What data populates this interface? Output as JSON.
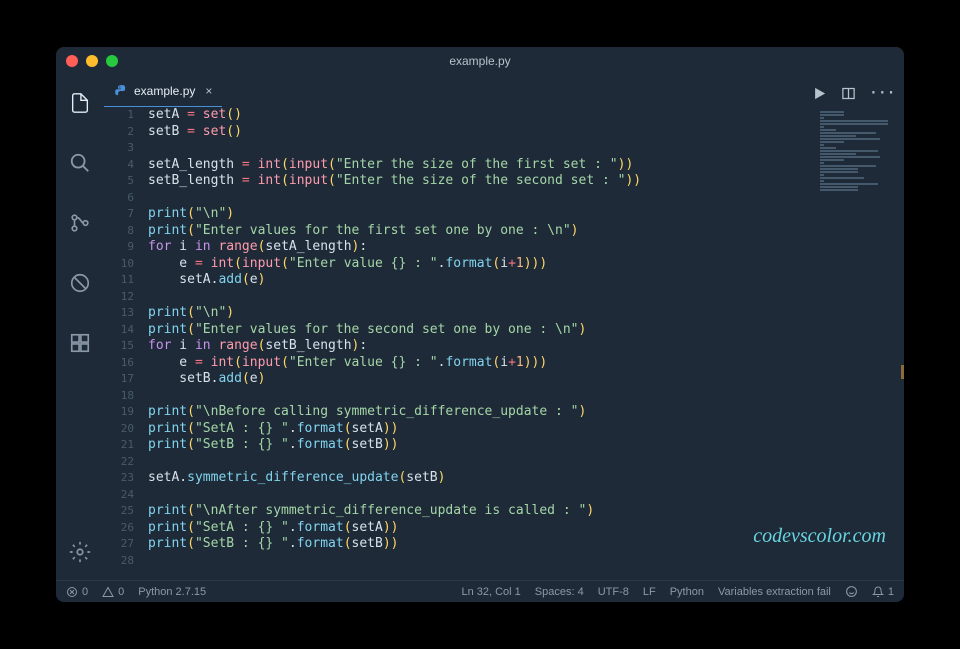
{
  "window": {
    "title": "example.py"
  },
  "tab": {
    "filename": "example.py"
  },
  "code_lines": [
    [
      [
        "var",
        "setA"
      ],
      [
        "op",
        " = "
      ],
      [
        "builtin",
        "set"
      ],
      [
        "paren",
        "()"
      ]
    ],
    [
      [
        "var",
        "setB"
      ],
      [
        "op",
        " = "
      ],
      [
        "builtin",
        "set"
      ],
      [
        "paren",
        "()"
      ]
    ],
    [],
    [
      [
        "var",
        "setA_length"
      ],
      [
        "op",
        " = "
      ],
      [
        "builtin",
        "int"
      ],
      [
        "paren",
        "("
      ],
      [
        "builtin",
        "input"
      ],
      [
        "paren",
        "("
      ],
      [
        "str",
        "\"Enter the size of the first set : \""
      ],
      [
        "paren",
        "))"
      ]
    ],
    [
      [
        "var",
        "setB_length"
      ],
      [
        "op",
        " = "
      ],
      [
        "builtin",
        "int"
      ],
      [
        "paren",
        "("
      ],
      [
        "builtin",
        "input"
      ],
      [
        "paren",
        "("
      ],
      [
        "str",
        "\"Enter the size of the second set : \""
      ],
      [
        "paren",
        "))"
      ]
    ],
    [],
    [
      [
        "call",
        "print"
      ],
      [
        "paren",
        "("
      ],
      [
        "str",
        "\"\\n\""
      ],
      [
        "paren",
        ")"
      ]
    ],
    [
      [
        "call",
        "print"
      ],
      [
        "paren",
        "("
      ],
      [
        "str",
        "\"Enter values for the first set one by one : \\n\""
      ],
      [
        "paren",
        ")"
      ]
    ],
    [
      [
        "kw",
        "for"
      ],
      [
        "var",
        " i "
      ],
      [
        "kw",
        "in"
      ],
      [
        "var",
        " "
      ],
      [
        "builtin",
        "range"
      ],
      [
        "paren",
        "("
      ],
      [
        "var",
        "setA_length"
      ],
      [
        "paren",
        ")"
      ],
      [
        "var",
        ":"
      ]
    ],
    [
      [
        "var",
        "    e"
      ],
      [
        "op",
        " = "
      ],
      [
        "builtin",
        "int"
      ],
      [
        "paren",
        "("
      ],
      [
        "builtin",
        "input"
      ],
      [
        "paren",
        "("
      ],
      [
        "str",
        "\"Enter value {} : \""
      ],
      [
        "var",
        "."
      ],
      [
        "method",
        "format"
      ],
      [
        "paren",
        "("
      ],
      [
        "var",
        "i"
      ],
      [
        "op",
        "+"
      ],
      [
        "num",
        "1"
      ],
      [
        "paren",
        ")))"
      ]
    ],
    [
      [
        "var",
        "    setA."
      ],
      [
        "method",
        "add"
      ],
      [
        "paren",
        "("
      ],
      [
        "var",
        "e"
      ],
      [
        "paren",
        ")"
      ]
    ],
    [],
    [
      [
        "call",
        "print"
      ],
      [
        "paren",
        "("
      ],
      [
        "str",
        "\"\\n\""
      ],
      [
        "paren",
        ")"
      ]
    ],
    [
      [
        "call",
        "print"
      ],
      [
        "paren",
        "("
      ],
      [
        "str",
        "\"Enter values for the second set one by one : \\n\""
      ],
      [
        "paren",
        ")"
      ]
    ],
    [
      [
        "kw",
        "for"
      ],
      [
        "var",
        " i "
      ],
      [
        "kw",
        "in"
      ],
      [
        "var",
        " "
      ],
      [
        "builtin",
        "range"
      ],
      [
        "paren",
        "("
      ],
      [
        "var",
        "setB_length"
      ],
      [
        "paren",
        ")"
      ],
      [
        "var",
        ":"
      ]
    ],
    [
      [
        "var",
        "    e"
      ],
      [
        "op",
        " = "
      ],
      [
        "builtin",
        "int"
      ],
      [
        "paren",
        "("
      ],
      [
        "builtin",
        "input"
      ],
      [
        "paren",
        "("
      ],
      [
        "str",
        "\"Enter value {} : \""
      ],
      [
        "var",
        "."
      ],
      [
        "method",
        "format"
      ],
      [
        "paren",
        "("
      ],
      [
        "var",
        "i"
      ],
      [
        "op",
        "+"
      ],
      [
        "num",
        "1"
      ],
      [
        "paren",
        ")))"
      ]
    ],
    [
      [
        "var",
        "    setB."
      ],
      [
        "method",
        "add"
      ],
      [
        "paren",
        "("
      ],
      [
        "var",
        "e"
      ],
      [
        "paren",
        ")"
      ]
    ],
    [],
    [
      [
        "call",
        "print"
      ],
      [
        "paren",
        "("
      ],
      [
        "str",
        "\"\\nBefore calling symmetric_difference_update : \""
      ],
      [
        "paren",
        ")"
      ]
    ],
    [
      [
        "call",
        "print"
      ],
      [
        "paren",
        "("
      ],
      [
        "str",
        "\"SetA : {} \""
      ],
      [
        "var",
        "."
      ],
      [
        "method",
        "format"
      ],
      [
        "paren",
        "("
      ],
      [
        "var",
        "setA"
      ],
      [
        "paren",
        "))"
      ]
    ],
    [
      [
        "call",
        "print"
      ],
      [
        "paren",
        "("
      ],
      [
        "str",
        "\"SetB : {} \""
      ],
      [
        "var",
        "."
      ],
      [
        "method",
        "format"
      ],
      [
        "paren",
        "("
      ],
      [
        "var",
        "setB"
      ],
      [
        "paren",
        "))"
      ]
    ],
    [],
    [
      [
        "var",
        "setA."
      ],
      [
        "method",
        "symmetric_difference_update"
      ],
      [
        "paren",
        "("
      ],
      [
        "var",
        "setB"
      ],
      [
        "paren",
        ")"
      ]
    ],
    [],
    [
      [
        "call",
        "print"
      ],
      [
        "paren",
        "("
      ],
      [
        "str",
        "\"\\nAfter symmetric_difference_update is called : \""
      ],
      [
        "paren",
        ")"
      ]
    ],
    [
      [
        "call",
        "print"
      ],
      [
        "paren",
        "("
      ],
      [
        "str",
        "\"SetA : {} \""
      ],
      [
        "var",
        "."
      ],
      [
        "method",
        "format"
      ],
      [
        "paren",
        "("
      ],
      [
        "var",
        "setA"
      ],
      [
        "paren",
        "))"
      ]
    ],
    [
      [
        "call",
        "print"
      ],
      [
        "paren",
        "("
      ],
      [
        "str",
        "\"SetB : {} \""
      ],
      [
        "var",
        "."
      ],
      [
        "method",
        "format"
      ],
      [
        "paren",
        "("
      ],
      [
        "var",
        "setB"
      ],
      [
        "paren",
        "))"
      ]
    ],
    []
  ],
  "line_start": 1,
  "statusbar": {
    "errors": "0",
    "warnings": "0",
    "python_version": "Python 2.7.15",
    "cursor": "Ln 32, Col 1",
    "spaces": "Spaces: 4",
    "encoding": "UTF-8",
    "eol": "LF",
    "language": "Python",
    "extra": "Variables extraction fail",
    "notifications": "1"
  },
  "watermark": "codevscolor.com"
}
